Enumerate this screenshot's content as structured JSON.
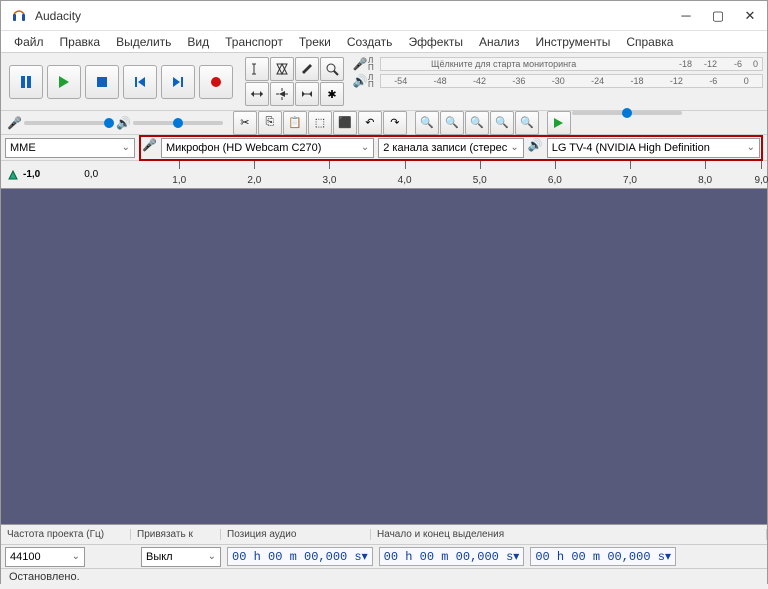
{
  "window": {
    "title": "Audacity"
  },
  "menu": [
    "Файл",
    "Правка",
    "Выделить",
    "Вид",
    "Транспорт",
    "Треки",
    "Создать",
    "Эффекты",
    "Анализ",
    "Инструменты",
    "Справка"
  ],
  "meter": {
    "click_text": "Щёлкните для старта мониторинга",
    "ticks": [
      "-54",
      "-48",
      "-42",
      "-36",
      "-30",
      "-24",
      "-18",
      "-12",
      "-6",
      "0"
    ]
  },
  "devices": {
    "host": "MME",
    "input": "Микрофон (HD Webcam C270)",
    "channels": "2 канала записи (стерес",
    "output": "LG TV-4 (NVIDIA High Definition"
  },
  "timeline": {
    "start": "-1,0",
    "zero": "0,0",
    "ticks": [
      "1,0",
      "2,0",
      "3,0",
      "4,0",
      "5,0",
      "6,0",
      "7,0",
      "8,0",
      "9,0"
    ]
  },
  "status": {
    "rate_label": "Частота проекта (Гц)",
    "rate_value": "44100",
    "snap_label": "Привязать к",
    "snap_value": "Выкл",
    "pos_label": "Позиция аудио",
    "sel_label": "Начало и конец выделения",
    "timecode": "00 h 00 m 00,000 s",
    "state": "Остановлено."
  }
}
